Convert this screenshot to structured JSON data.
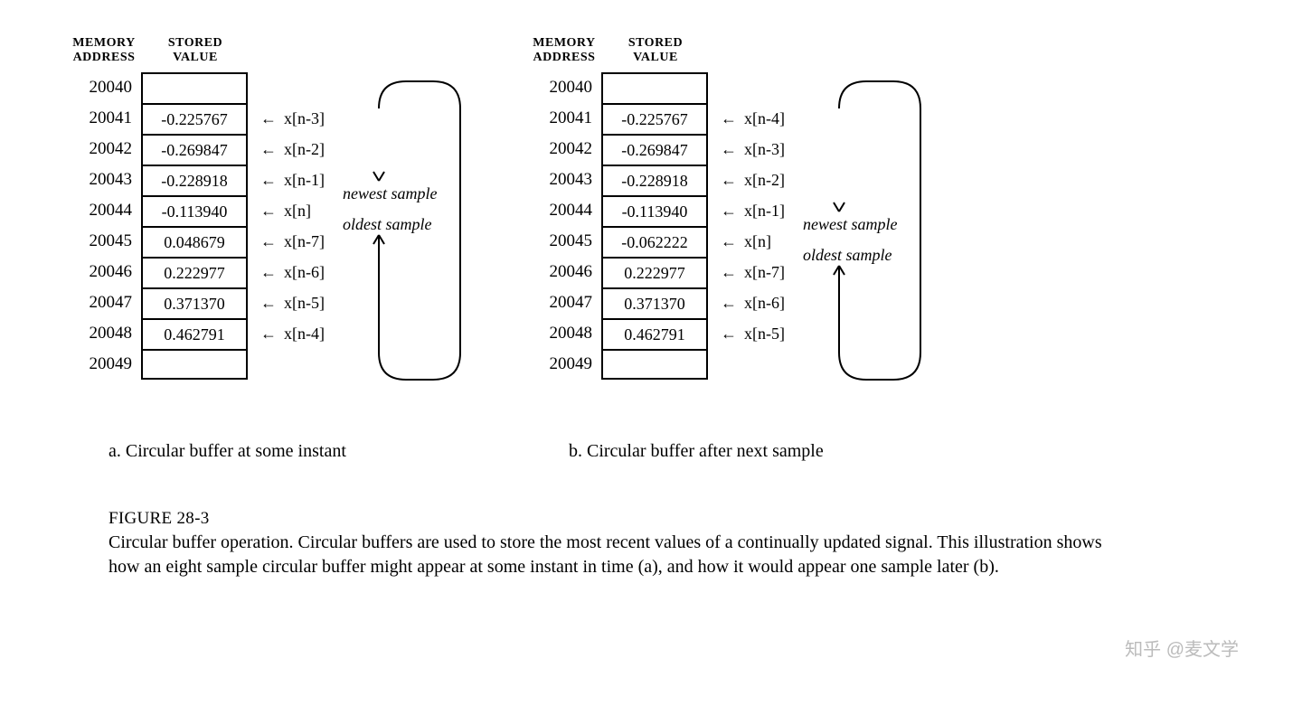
{
  "headers": {
    "memory": "MEMORY\nADDRESS",
    "value": "STORED\nVALUE"
  },
  "diagramA": {
    "rows": [
      {
        "addr": "20040",
        "value": "",
        "ptr": ""
      },
      {
        "addr": "20041",
        "value": "-0.225767",
        "ptr": "x[n-3]"
      },
      {
        "addr": "20042",
        "value": "-0.269847",
        "ptr": "x[n-2]"
      },
      {
        "addr": "20043",
        "value": "-0.228918",
        "ptr": "x[n-1]"
      },
      {
        "addr": "20044",
        "value": "-0.113940",
        "ptr": "x[n]"
      },
      {
        "addr": "20045",
        "value": "0.048679",
        "ptr": "x[n-7]"
      },
      {
        "addr": "20046",
        "value": "0.222977",
        "ptr": "x[n-6]"
      },
      {
        "addr": "20047",
        "value": "0.371370",
        "ptr": "x[n-5]"
      },
      {
        "addr": "20048",
        "value": "0.462791",
        "ptr": "x[n-4]"
      },
      {
        "addr": "20049",
        "value": "",
        "ptr": ""
      }
    ],
    "newest": "newest sample",
    "oldest": "oldest sample",
    "caption": "a.  Circular buffer at some instant"
  },
  "diagramB": {
    "rows": [
      {
        "addr": "20040",
        "value": "",
        "ptr": ""
      },
      {
        "addr": "20041",
        "value": "-0.225767",
        "ptr": "x[n-4]"
      },
      {
        "addr": "20042",
        "value": "-0.269847",
        "ptr": "x[n-3]"
      },
      {
        "addr": "20043",
        "value": "-0.228918",
        "ptr": "x[n-2]"
      },
      {
        "addr": "20044",
        "value": "-0.113940",
        "ptr": "x[n-1]"
      },
      {
        "addr": "20045",
        "value": "-0.062222",
        "ptr": "x[n]"
      },
      {
        "addr": "20046",
        "value": "0.222977",
        "ptr": "x[n-7]"
      },
      {
        "addr": "20047",
        "value": "0.371370",
        "ptr": "x[n-6]"
      },
      {
        "addr": "20048",
        "value": "0.462791",
        "ptr": "x[n-5]"
      },
      {
        "addr": "20049",
        "value": "",
        "ptr": ""
      }
    ],
    "newest": "newest sample",
    "oldest": "oldest sample",
    "caption": "b.  Circular buffer after next sample"
  },
  "figure": {
    "label": "FIGURE 28-3",
    "text": "Circular buffer operation. Circular buffers are used to store the most recent values of a continually updated signal.  This illustration shows how an eight sample circular buffer might appear at some instant in time (a), and how it would appear one sample later (b)."
  },
  "watermark": "知乎 @麦文学",
  "arrowGlyph": "←"
}
